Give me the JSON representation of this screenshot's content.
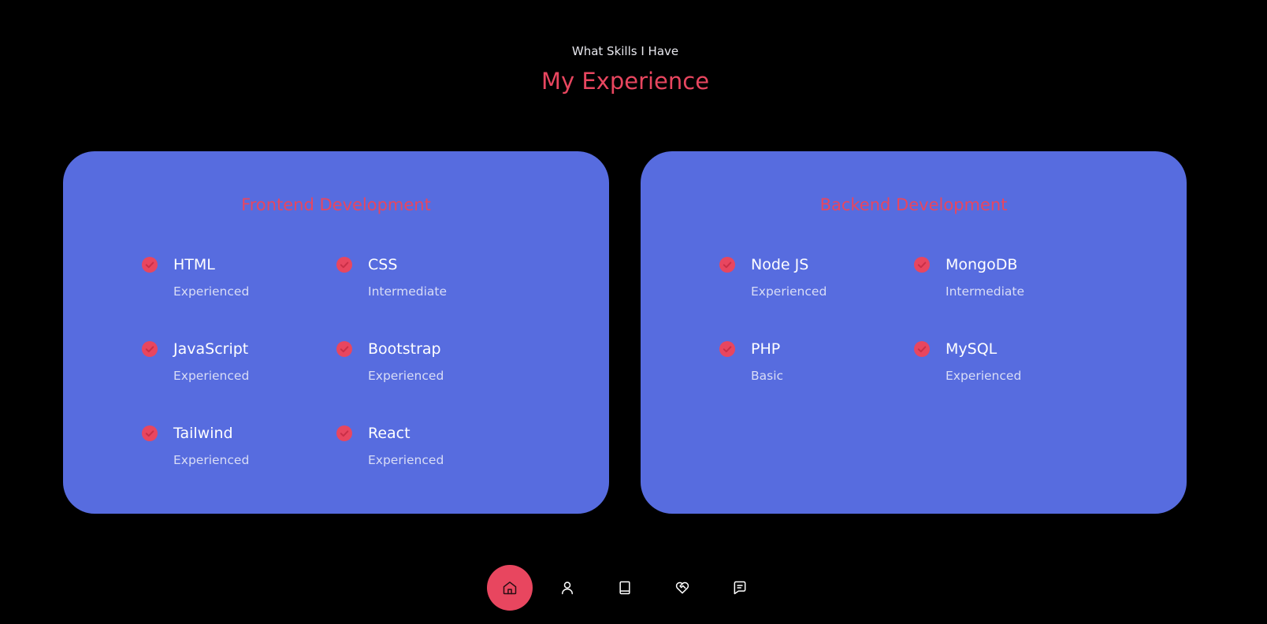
{
  "header": {
    "subtitle": "What Skills I Have",
    "title": "My Experience"
  },
  "colors": {
    "accent": "#e8465f",
    "card": "#576cdf",
    "background": "#000000"
  },
  "frontend": {
    "title": "Frontend Development",
    "skills": [
      {
        "name": "HTML",
        "level": "Experienced"
      },
      {
        "name": "CSS",
        "level": "Intermediate"
      },
      {
        "name": "JavaScript",
        "level": "Experienced"
      },
      {
        "name": "Bootstrap",
        "level": "Experienced"
      },
      {
        "name": "Tailwind",
        "level": "Experienced"
      },
      {
        "name": "React",
        "level": "Experienced"
      }
    ]
  },
  "backend": {
    "title": "Backend Development",
    "skills": [
      {
        "name": "Node JS",
        "level": "Experienced"
      },
      {
        "name": "MongoDB",
        "level": "Intermediate"
      },
      {
        "name": "PHP",
        "level": "Basic"
      },
      {
        "name": "MySQL",
        "level": "Experienced"
      }
    ]
  },
  "nav": {
    "items": [
      {
        "icon": "home-icon",
        "active": true
      },
      {
        "icon": "user-icon",
        "active": false
      },
      {
        "icon": "book-icon",
        "active": false
      },
      {
        "icon": "heart-handshake-icon",
        "active": false
      },
      {
        "icon": "message-square-icon",
        "active": false
      }
    ]
  }
}
